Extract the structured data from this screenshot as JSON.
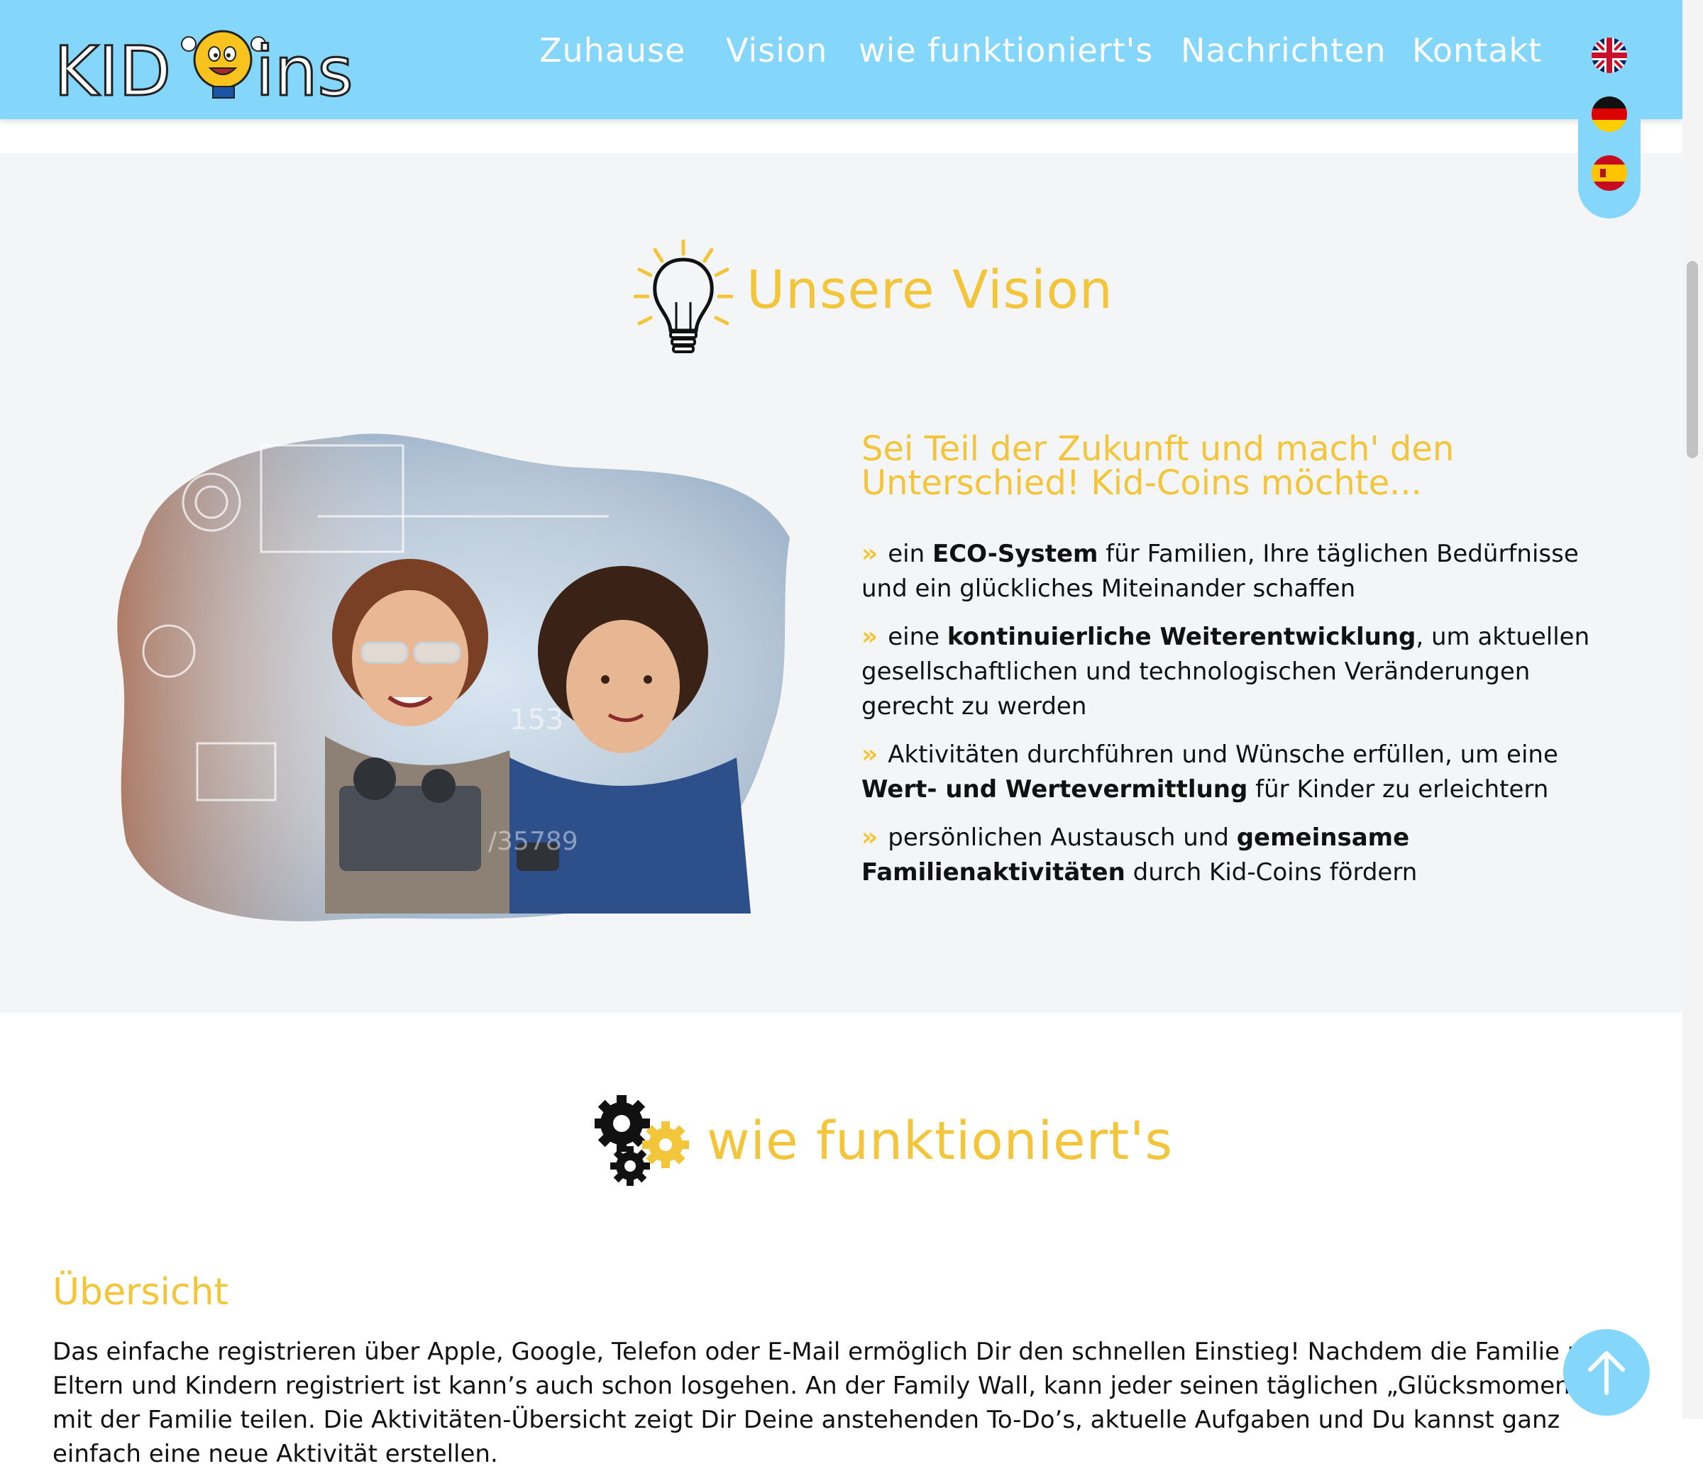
{
  "header": {
    "logo_text_left": "KID",
    "logo_text_right": "ins",
    "nav": [
      "Zuhause",
      "Vision",
      "wie funktioniert's",
      "Nachrichten",
      "Kontakt"
    ]
  },
  "languages": [
    "English",
    "Deutsch",
    "Español"
  ],
  "vision": {
    "title": "Unsere Vision",
    "subtitle": "Sei Teil der Zukunft und mach' den Unterschied! Kid-Coins möchte...",
    "bullet_mark": "»",
    "items": [
      {
        "pre": "ein ",
        "bold": "ECO-System",
        "post": " für Familien, Ihre täglichen Bedürfnisse und ein glückliches Miteinander schaffen"
      },
      {
        "pre": "eine ",
        "bold": "kontinuierliche Weiterentwicklung",
        "post": ", um aktuellen gesellschaftlichen und technologischen Veränderungen gerecht zu werden"
      },
      {
        "pre": "Aktivitäten durchführen und Wünsche erfüllen, um eine ",
        "bold": "Wert- und Wertevermittlung",
        "post": " für Kinder zu erleichtern"
      },
      {
        "pre": "persönlichen Austausch und ",
        "bold": "gemeinsame Familienaktivitäten",
        "post": " durch Kid-Coins fördern"
      }
    ]
  },
  "how": {
    "title": "wie funktioniert's",
    "overview_title": "Übersicht",
    "overview_text": "Das einfache registrieren über Apple, Google, Telefon oder E-Mail ermöglich Dir den schnellen Einstieg! Nachdem die Familie mit Eltern und Kindern registriert ist kann’s auch schon losgehen. An der Family Wall, kann jeder seinen täglichen „Glücksmomente“ mit der Familie teilen. Die Aktivitäten-Übersicht zeigt Dir Deine anstehenden To-Do’s, aktuelle Aufgaben und Du kannst ganz einfach eine neue Aktivität erstellen."
  },
  "icons": {
    "bulb": "lightbulb-icon",
    "gears": "gears-icon",
    "arrow_up": "arrow-up-icon"
  },
  "colors": {
    "header_bg": "#84d6fb",
    "accent": "#f3c53a",
    "section_bg": "#f4f5f7"
  }
}
